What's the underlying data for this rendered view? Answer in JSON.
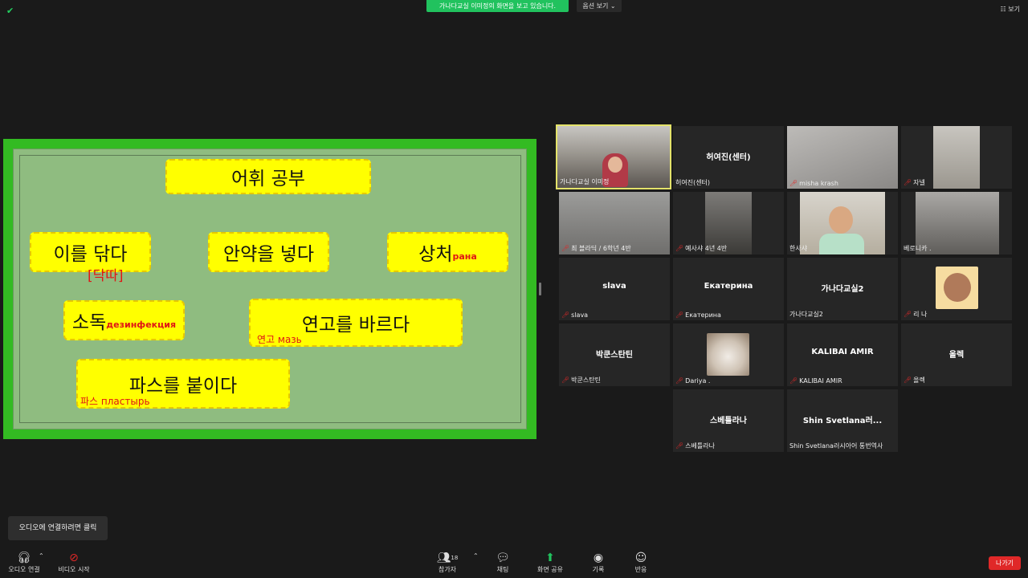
{
  "top": {
    "share_banner": "가나다교실 이미정의 화면을 보고 있습니다.",
    "view_options": "옵션 보기 ⌄",
    "view": "보기"
  },
  "slide": {
    "cards": [
      {
        "text": "어휘 공부",
        "note": ""
      },
      {
        "text": "이를 닦다",
        "note": "[닥따]"
      },
      {
        "text": "안약을 넣다",
        "note": ""
      },
      {
        "text": "상처",
        "note": "рана"
      },
      {
        "text": "소독",
        "note": "дезинфекция"
      },
      {
        "text": "연고를 바르다",
        "note": "연고 мазь"
      },
      {
        "text": "파스를 붙이다",
        "note": "파스 пластырь"
      }
    ]
  },
  "participants": [
    {
      "name": "가나다교실 이미정",
      "center": ""
    },
    {
      "name": "허여진(센터)",
      "center": "허여진(센터)"
    },
    {
      "name": "misha krash",
      "center": ""
    },
    {
      "name": "자넬",
      "center": ""
    },
    {
      "name": "최 블라딕 / 6학년 4반",
      "center": ""
    },
    {
      "name": "예사샤 4년 4반",
      "center": ""
    },
    {
      "name": "한사샤",
      "center": ""
    },
    {
      "name": "베로니카 .",
      "center": ""
    },
    {
      "name": "slava",
      "center": "slava"
    },
    {
      "name": "Екатерина",
      "center": "Екатерина"
    },
    {
      "name": "가나다교실2",
      "center": "가나다교실2"
    },
    {
      "name": "리 나",
      "center": ""
    },
    {
      "name": "박쿤스탄틴",
      "center": "박쿤스탄틴"
    },
    {
      "name": "Dariya .",
      "center": ""
    },
    {
      "name": "KALIBAI AMIR",
      "center": "KALIBAI AMIR"
    },
    {
      "name": "올렉",
      "center": "올렉"
    },
    {
      "name": "스베틀라나",
      "center": "스베틀라나"
    },
    {
      "name": "Shin Svetlana러시아어 통번역사",
      "center": "Shin  Svetlana러..."
    }
  ],
  "bottom": {
    "tooltip": "오디오에 연결하려면 클릭",
    "audio": "오디오 연결",
    "video": "비디오 시작",
    "participants": "참가자",
    "participants_count": "18",
    "chat": "채팅",
    "share": "화면 공유",
    "record": "기록",
    "reactions": "반응",
    "leave": "나가기"
  },
  "colors": {
    "share_green": "#21c25e",
    "slide_green": "#33bb22",
    "card_yellow": "#ffff00",
    "leave_red": "#e02828"
  }
}
